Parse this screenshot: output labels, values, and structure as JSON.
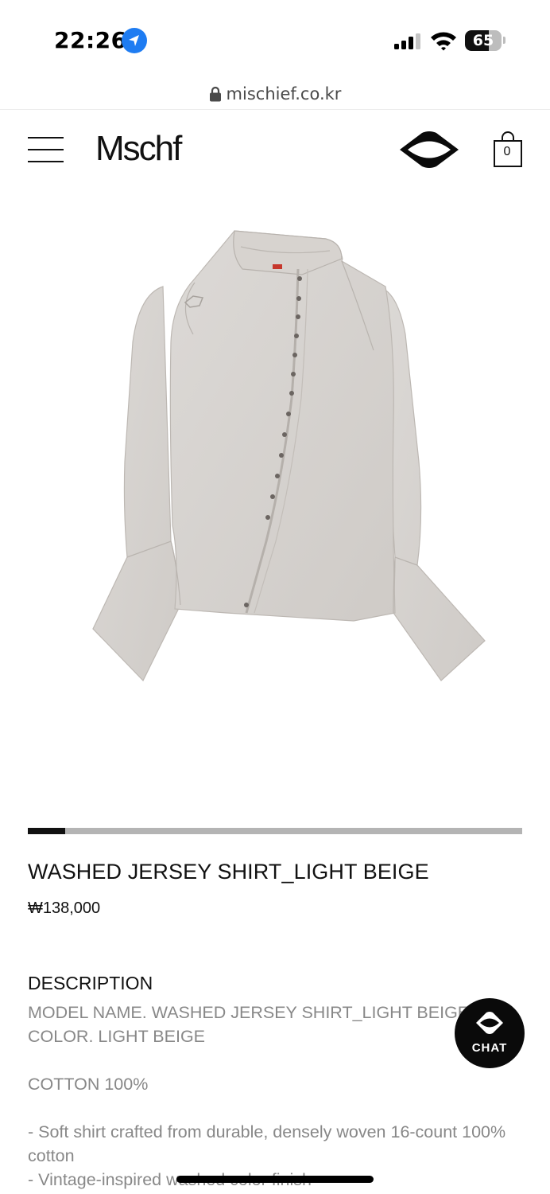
{
  "status_bar": {
    "time": "22:26",
    "battery_level": "65",
    "battery_fraction": 0.65,
    "icons": [
      "location-arrow-icon",
      "cellular-signal-icon",
      "wifi-icon",
      "battery-icon"
    ]
  },
  "browser": {
    "url": "mischief.co.kr",
    "lock_icon": "lock-icon"
  },
  "header": {
    "logo": "Mschf",
    "menu_icon": "hamburger-menu-icon",
    "brand_icon": "mischief-eye-logo-icon",
    "cart_count": "0"
  },
  "gallery": {
    "image_alt": "washed jersey shirt light beige product photo",
    "progress_fraction": 0.075,
    "colors": {
      "track": "#b4b4b4",
      "active": "#111111"
    }
  },
  "product": {
    "title": "WASHED JERSEY SHIRT_LIGHT BEIGE",
    "price": "₩138,000",
    "description_heading": "DESCRIPTION",
    "description_lines": [
      "MODEL NAME. WASHED JERSEY SHIRT_LIGHT BEIGE",
      "COLOR. LIGHT BEIGE",
      "COTTON 100%",
      "- Soft shirt crafted from durable, densely woven 16-count 100%",
      "cotton",
      "- Vintage-inspired washed color finish"
    ]
  },
  "chat": {
    "label": "CHAT",
    "icon": "chat-eye-icon"
  }
}
